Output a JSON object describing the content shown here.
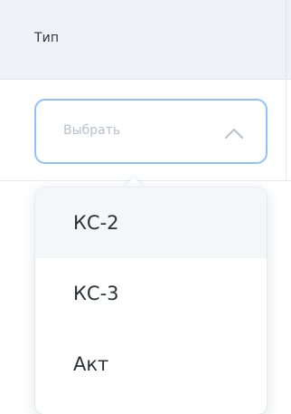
{
  "table": {
    "column_header": "Тип"
  },
  "select": {
    "placeholder": "Выбрать",
    "expanded": true,
    "icon": "chevron-up-icon"
  },
  "dropdown": {
    "options": [
      {
        "label": "КС-2",
        "highlighted": true
      },
      {
        "label": "КС-3",
        "highlighted": false
      },
      {
        "label": "Акт",
        "highlighted": false
      }
    ]
  },
  "colors": {
    "header_bg": "#eef1f6",
    "focus_border": "#8fc1ff",
    "placeholder_text": "#b9c0cb",
    "option_hover_bg": "#f4f6f9"
  }
}
